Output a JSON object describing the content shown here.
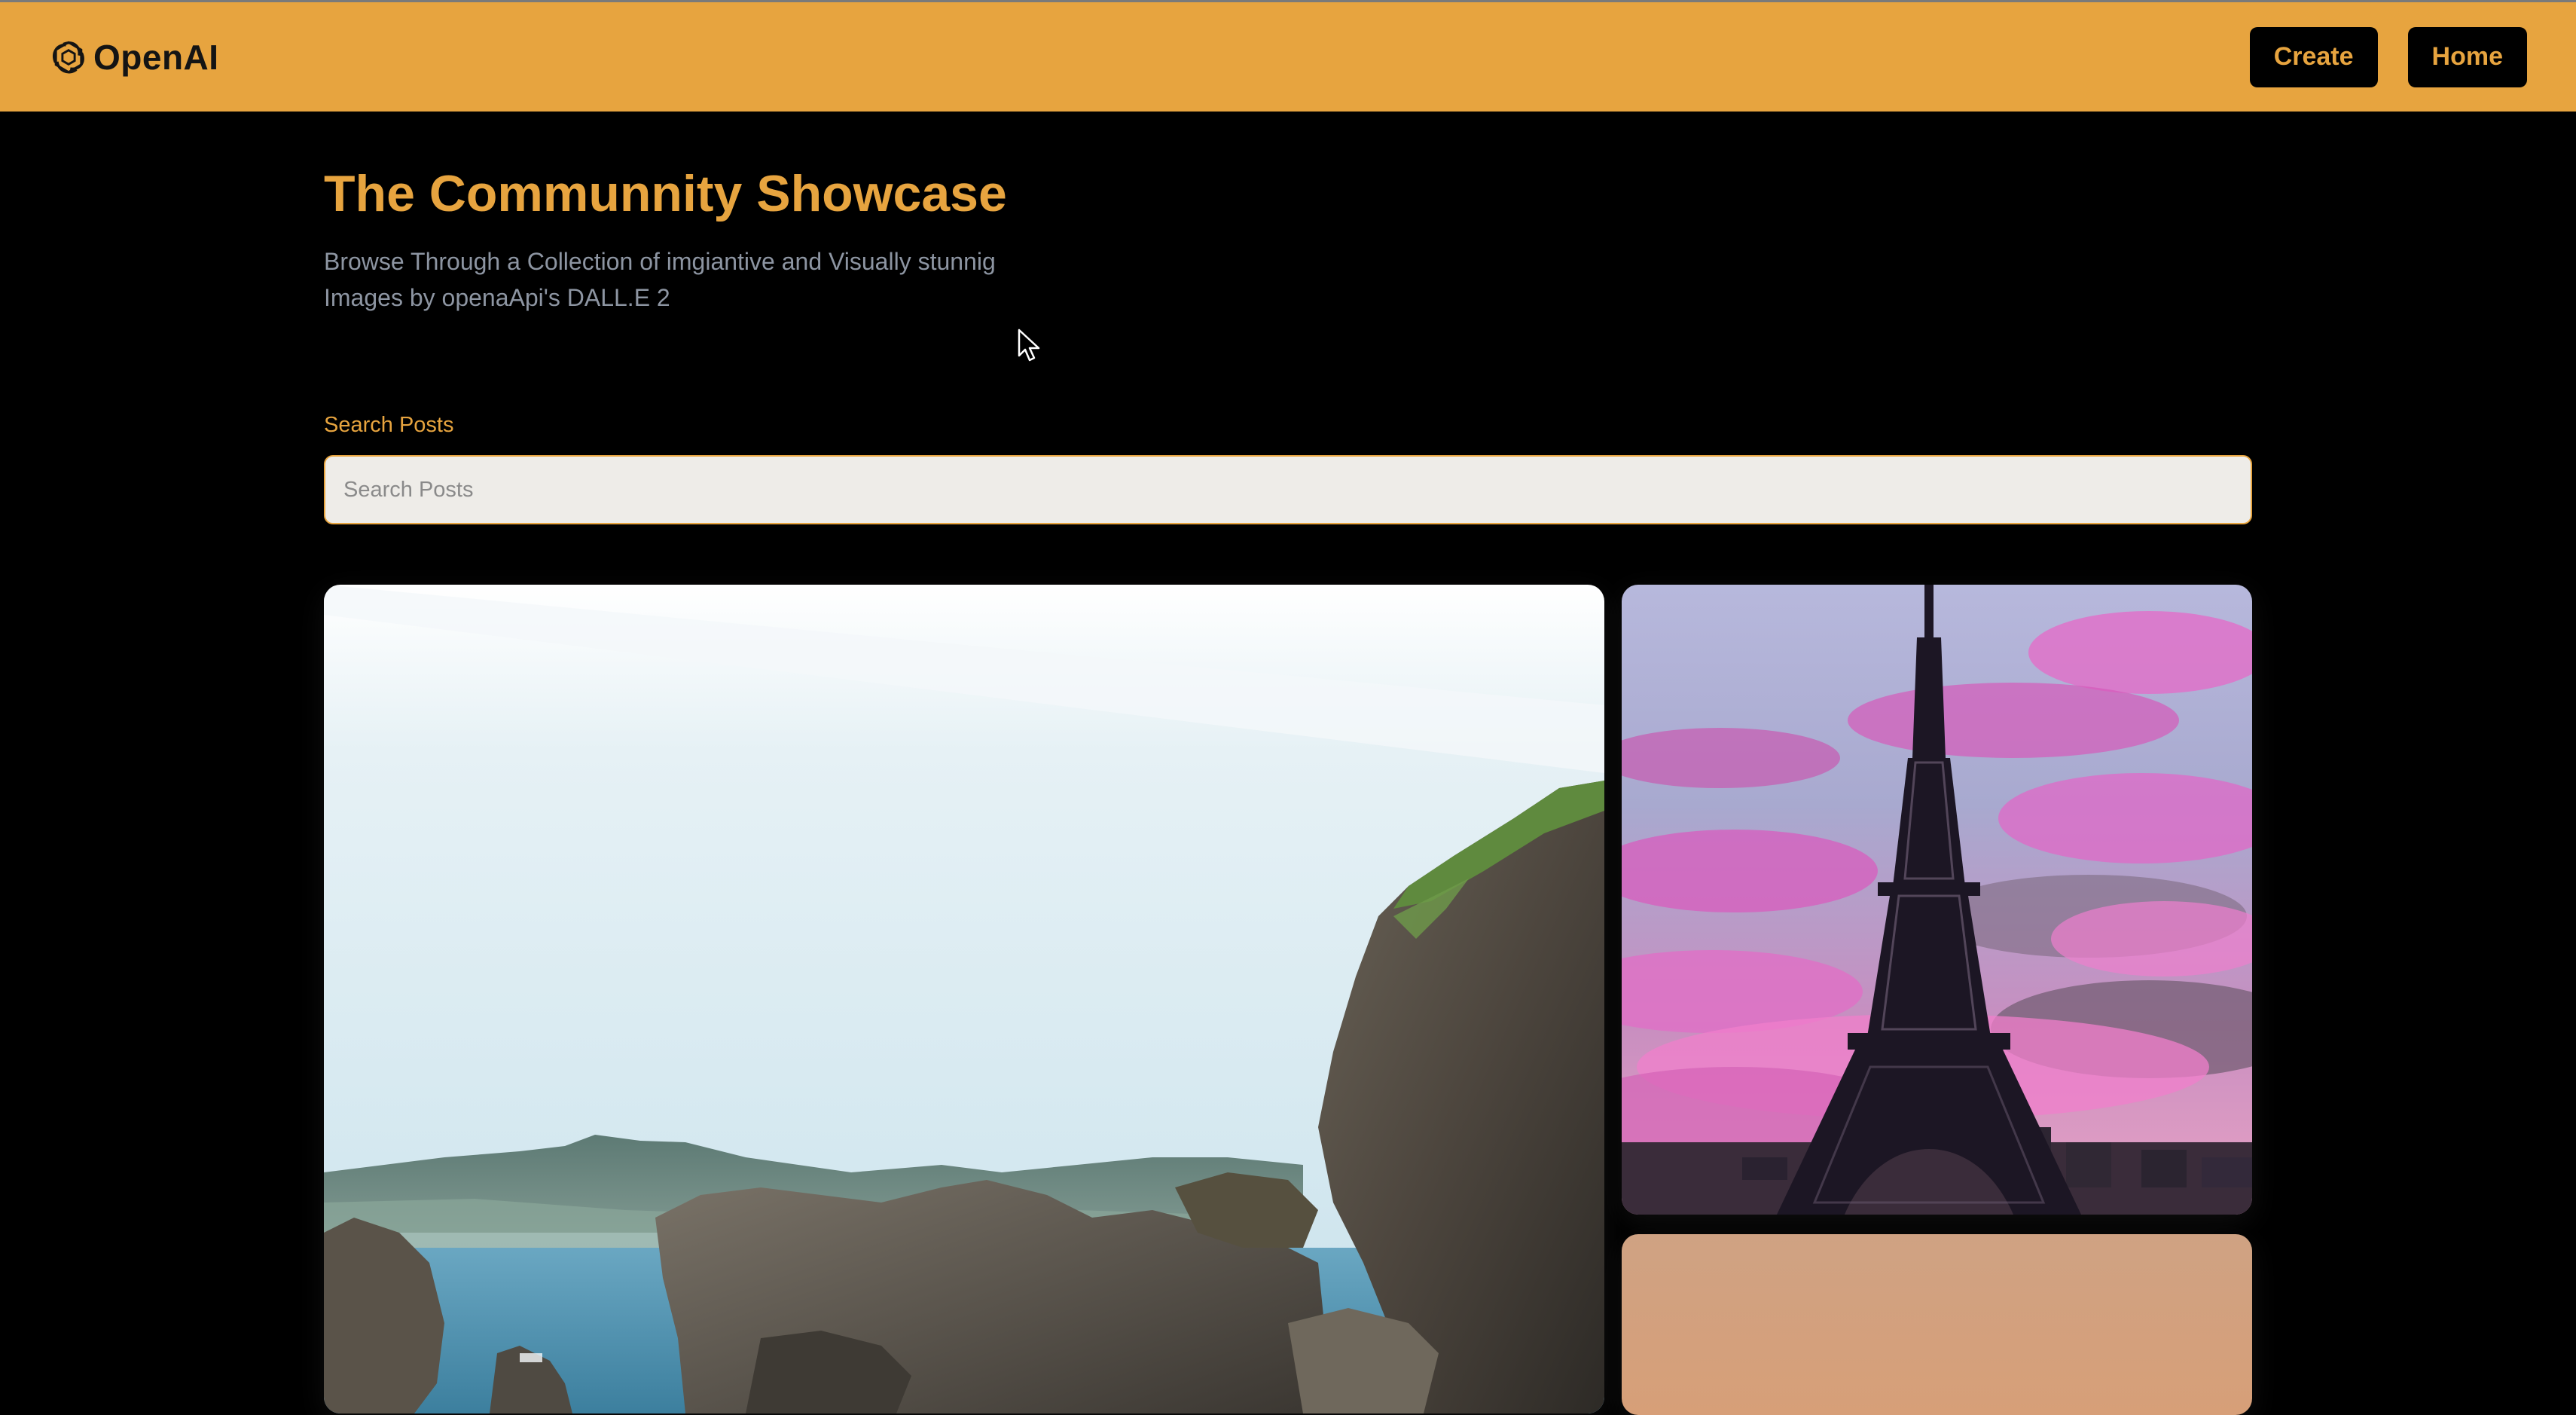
{
  "header": {
    "brand_name": "OpenAI",
    "brand_icon": "openai-logo-icon",
    "nav": [
      {
        "label": "Create"
      },
      {
        "label": "Home"
      }
    ],
    "colors": {
      "accent": "#e7a43f",
      "background": "#000000",
      "button_bg": "#000000"
    }
  },
  "main": {
    "title": "The Communnity Showcase",
    "subtitle": "Browse Through a Collection of imgiantive and Visually stunnig Images by openaApi's DALL.E 2",
    "search": {
      "label": "Search Posts",
      "placeholder": "Search Posts",
      "value": ""
    }
  },
  "gallery": [
    {
      "name": "coastal-rocks-image",
      "description_icon": "image"
    },
    {
      "name": "eiffel-tower-image",
      "description_icon": "image"
    },
    {
      "name": "sunset-image",
      "description_icon": "image"
    }
  ]
}
